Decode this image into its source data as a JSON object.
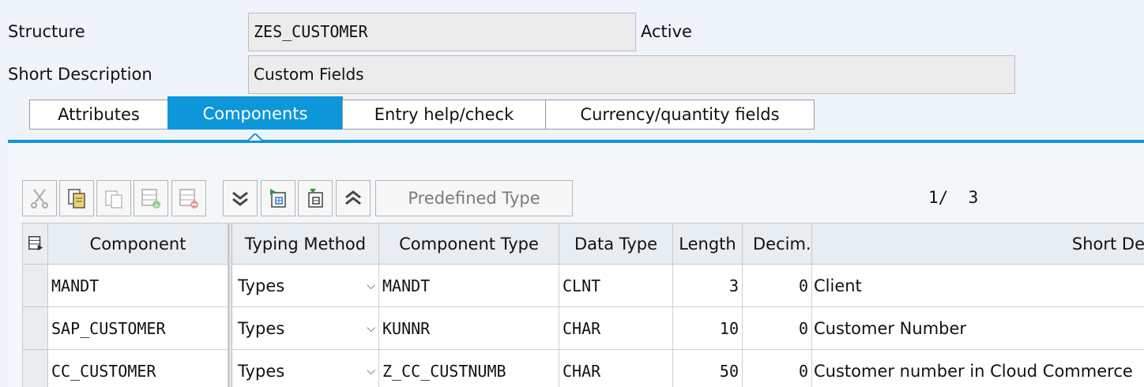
{
  "header": {
    "structure_label": "Structure",
    "structure_value": "ZES_CUSTOMER",
    "status": "Active",
    "short_desc_label": "Short Description",
    "short_desc_value": "Custom Fields"
  },
  "tabs": [
    {
      "label": "Attributes",
      "active": false
    },
    {
      "label": "Components",
      "active": true
    },
    {
      "label": "Entry help/check",
      "active": false
    },
    {
      "label": "Currency/quantity fields",
      "active": false
    }
  ],
  "toolbar": {
    "icons": [
      "cut-icon",
      "copy-icon",
      "paste-icon",
      "insert-row-icon",
      "delete-row-icon",
      "scroll-down-icon",
      "scroll-to-last-icon",
      "scroll-to-first-icon",
      "scroll-up-icon"
    ],
    "predefined_type_label": "Predefined Type",
    "page_indicator": "1/  3"
  },
  "colors": {
    "accent": "#0d96d9"
  },
  "table": {
    "columns": [
      "Component",
      "Typing Method",
      "Component Type",
      "Data Type",
      "Length",
      "Decim..",
      "Short De"
    ],
    "rows": [
      {
        "component": "MANDT",
        "typing": "Types",
        "comp_type": "MANDT",
        "data_type": "CLNT",
        "length": "3",
        "decimals": "0",
        "short_desc": "Client"
      },
      {
        "component": "SAP_CUSTOMER",
        "typing": "Types",
        "comp_type": "KUNNR",
        "data_type": "CHAR",
        "length": "10",
        "decimals": "0",
        "short_desc": "Customer Number"
      },
      {
        "component": "CC_CUSTOMER",
        "typing": "Types",
        "comp_type": "Z_CC_CUSTNUMB",
        "data_type": "CHAR",
        "length": "50",
        "decimals": "0",
        "short_desc": "Customer number in Cloud Commerce"
      }
    ]
  }
}
